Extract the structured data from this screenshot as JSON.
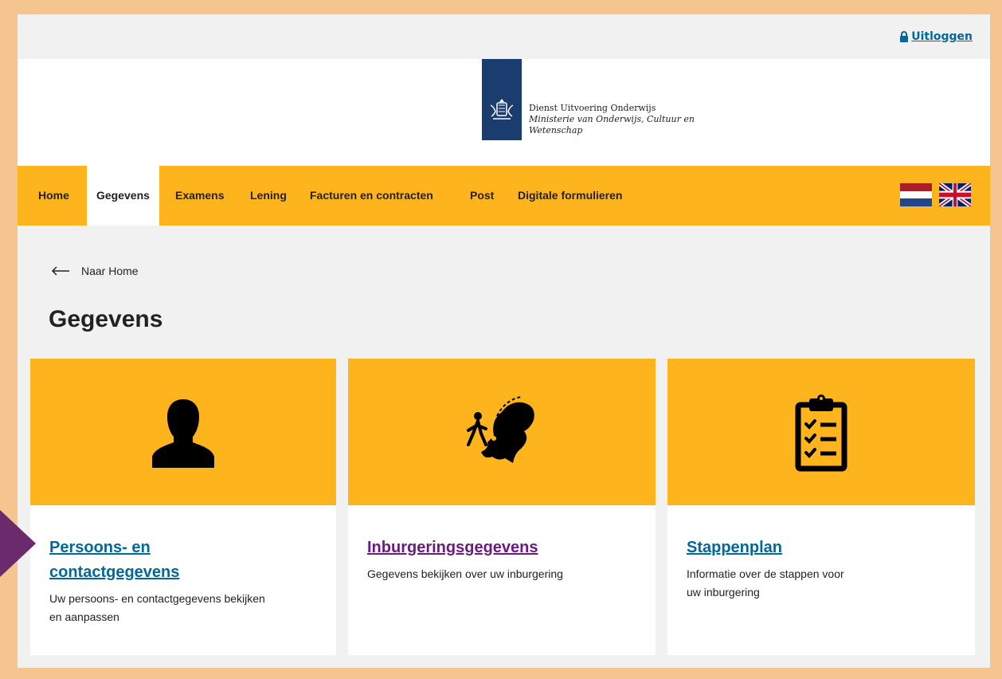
{
  "header": {
    "logout_label": "Uitloggen",
    "org_name": "Dienst Uitvoering Onderwijs",
    "ministry_line1": "Ministerie van Onderwijs, Cultuur en",
    "ministry_line2": "Wetenschap"
  },
  "nav": {
    "items": [
      {
        "label": "Home"
      },
      {
        "label": "Gegevens"
      },
      {
        "label": "Examens"
      },
      {
        "label": "Lening"
      },
      {
        "label": "Facturen en contracten"
      },
      {
        "label": "Post"
      },
      {
        "label": "Digitale formulieren"
      }
    ],
    "active": "Gegevens"
  },
  "breadcrumb": {
    "back_label": "Naar Home"
  },
  "page": {
    "title": "Gegevens"
  },
  "cards": [
    {
      "title_line1": "Persoons- en",
      "title_line2": "contactgegevens",
      "desc_line1": "Uw persoons- en contactgegevens bekijken",
      "desc_line2": "en aanpassen",
      "icon": "person-icon",
      "link_color": "#01689b"
    },
    {
      "title_line1": "Inburgeringsgegevens",
      "desc_line1": "Gegevens bekijken over uw inburgering",
      "icon": "integration-map-icon",
      "link_color": "#6a1b7f"
    },
    {
      "title_line1": "Stappenplan",
      "desc_line1": "Informatie over de stappen voor",
      "desc_line2": "uw inburgering",
      "icon": "clipboard-checklist-icon",
      "link_color": "#01689b"
    }
  ],
  "colors": {
    "accent": "#feb41c",
    "link": "#01689b",
    "visited_link": "#6a1b7f",
    "logo_blue": "#1a3c6e",
    "marker": "#6b2a6b"
  }
}
